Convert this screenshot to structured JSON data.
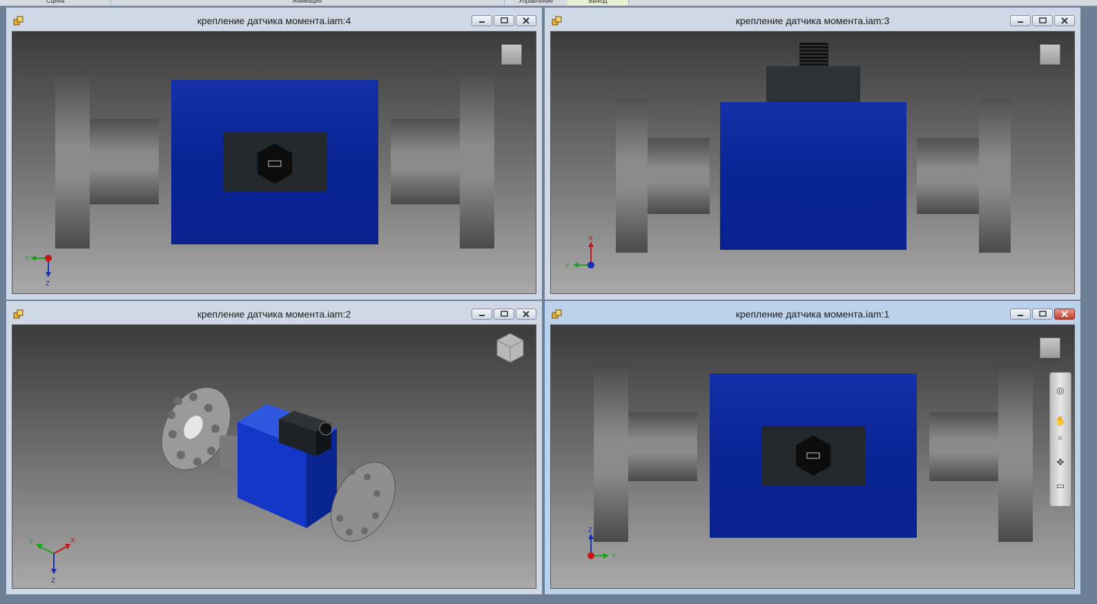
{
  "ribbon": {
    "tabs": [
      "Сцена",
      "Анимация",
      "Управление",
      "Выход"
    ]
  },
  "windows": [
    {
      "id": "w4",
      "title": "крепление датчика момента.iam:4",
      "view": "top"
    },
    {
      "id": "w3",
      "title": "крепление датчика момента.iam:3",
      "view": "side"
    },
    {
      "id": "w2",
      "title": "крепление датчика момента.iam:2",
      "view": "iso"
    },
    {
      "id": "w1",
      "title": "крепление датчика момента.iam:1",
      "view": "front",
      "active": true
    }
  ],
  "axes": {
    "x": "X",
    "y": "Y",
    "z": "Z"
  },
  "colors": {
    "accent_blue": "#0b2a9c",
    "window_frame": "#cfd9e6",
    "active_window": "#bcd2ea",
    "close_red": "#c23a2a"
  },
  "icons": {
    "window": [
      "app-icon",
      "minimize-icon",
      "restore-icon",
      "close-icon"
    ],
    "navigation": [
      "steering-wheel-icon",
      "pan-icon",
      "zoom-icon",
      "orbit-icon",
      "look-icon"
    ]
  }
}
